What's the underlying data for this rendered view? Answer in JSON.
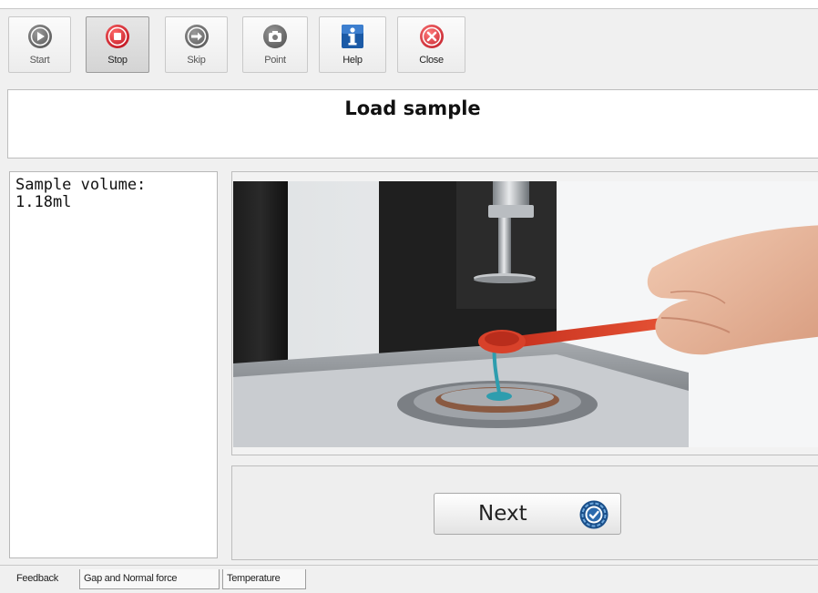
{
  "toolbar": {
    "start_label": "Start",
    "stop_label": "Stop",
    "skip_label": "Skip",
    "point_label": "Point",
    "help_label": "Help",
    "close_label": "Close"
  },
  "step": {
    "title": "Load sample"
  },
  "feedback": {
    "line1": "Sample volume:",
    "line2": "1.18ml"
  },
  "action": {
    "next_label": "Next"
  },
  "tabs": [
    "Feedback",
    "Gap and Normal force",
    "Temperature"
  ],
  "colors": {
    "stop_red": "#d9232e",
    "help_blue": "#1b5aa6",
    "close_red": "#d9343c",
    "spoon_orange": "#e0452c",
    "sample_teal": "#2e9dae"
  },
  "icons": {
    "start": "play-circle-icon",
    "stop": "stop-circle-icon",
    "skip": "arrow-right-circle-icon",
    "point": "camera-icon",
    "help": "info-icon",
    "close": "close-circle-icon",
    "next": "checkmark-dial-icon"
  }
}
